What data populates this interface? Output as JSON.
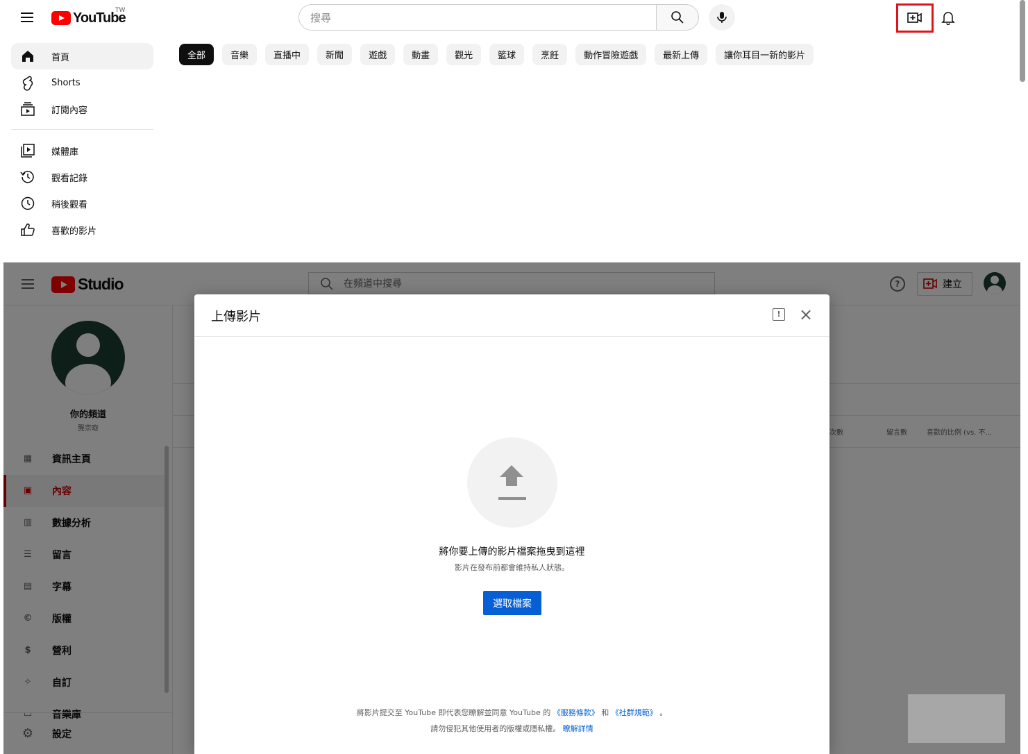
{
  "youtube": {
    "logo_text": "YouTube",
    "region": "TW",
    "search_placeholder": "搜尋",
    "sidebar": [
      {
        "label": "首頁",
        "icon": "home-icon",
        "active": true
      },
      {
        "label": "Shorts",
        "icon": "shorts-icon",
        "active": false
      },
      {
        "label": "訂閱內容",
        "icon": "subscriptions-icon",
        "active": false
      },
      {
        "label": "媒體庫",
        "icon": "library-icon",
        "active": false
      },
      {
        "label": "觀看記錄",
        "icon": "history-icon",
        "active": false
      },
      {
        "label": "稍後觀看",
        "icon": "watch-later-icon",
        "active": false
      },
      {
        "label": "喜歡的影片",
        "icon": "liked-videos-icon",
        "active": false
      }
    ],
    "chips": [
      "全部",
      "音樂",
      "直播中",
      "新聞",
      "遊戲",
      "動畫",
      "觀光",
      "籃球",
      "烹飪",
      "動作冒險遊戲",
      "最新上傳",
      "讓你耳目一新的影片"
    ]
  },
  "studio": {
    "logo_text": "Studio",
    "search_placeholder": "在頻道中搜尋",
    "create_label": "建立",
    "channel_title": "你的頻道",
    "channel_name": "龔宗琁",
    "nav": [
      {
        "label": "資訊主頁",
        "icon": "dashboard-icon",
        "active": false
      },
      {
        "label": "內容",
        "icon": "content-icon",
        "active": true
      },
      {
        "label": "數據分析",
        "icon": "analytics-icon",
        "active": false
      },
      {
        "label": "留言",
        "icon": "comments-icon",
        "active": false
      },
      {
        "label": "字幕",
        "icon": "subtitles-icon",
        "active": false
      },
      {
        "label": "版權",
        "icon": "copyright-icon",
        "active": false
      },
      {
        "label": "營利",
        "icon": "monetization-icon",
        "active": false
      },
      {
        "label": "自訂",
        "icon": "customization-icon",
        "active": false
      },
      {
        "label": "音樂庫",
        "icon": "audio-library-icon",
        "active": false
      }
    ],
    "settings_label": "設定",
    "table_columns": [
      "次數",
      "留言數",
      "喜歡的比例 (vs. 不..."
    ],
    "dialog": {
      "title": "上傳影片",
      "main_text": "將你要上傳的影片檔案拖曳到這裡",
      "sub_text": "影片在發布前都會維持私人狀態。",
      "select_button": "選取檔案",
      "terms_prefix": "將影片提交至 YouTube 即代表您瞭解並同意 YouTube 的",
      "terms_link": "《服務條款》",
      "terms_and": "和",
      "guidelines_link": "《社群規範》",
      "terms_suffix": "。",
      "rights_text": "請勿侵犯其他使用者的版權或隱私權。",
      "learn_more": "瞭解詳情"
    }
  },
  "colors": {
    "youtube_red": "#ff0000",
    "highlight_box": "#e0131c",
    "studio_active": "#cc0000",
    "primary_button": "#065fd4"
  }
}
